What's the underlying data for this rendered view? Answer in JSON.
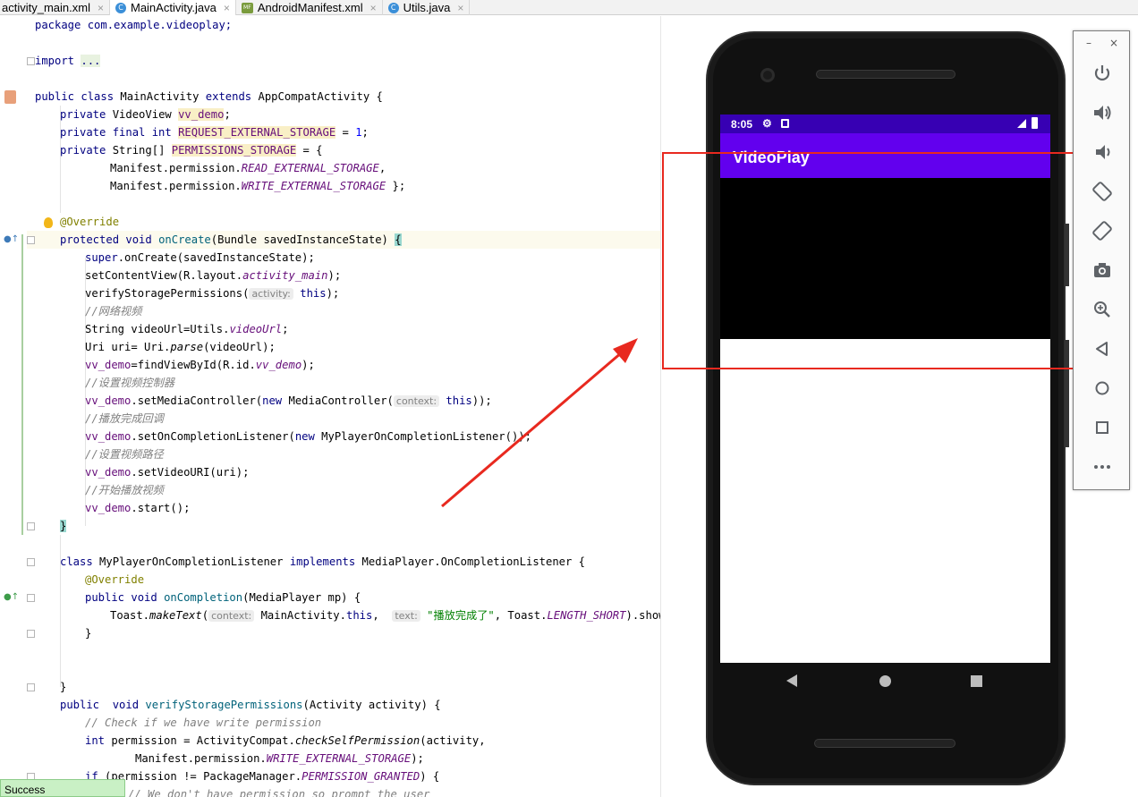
{
  "tabs": [
    {
      "label": "activity_main.xml",
      "icon": "xml-file-icon"
    },
    {
      "label": "MainActivity.java",
      "icon": "java-class-icon",
      "active": true
    },
    {
      "label": "AndroidManifest.xml",
      "icon": "manifest-file-icon"
    },
    {
      "label": "Utils.java",
      "icon": "java-class-icon"
    }
  ],
  "code": {
    "l1": "package com.example.videoplay;",
    "import_kw": "import",
    "import_fold": "...",
    "class_decl_a": "public class ",
    "class_decl_b": "MainActivity ",
    "class_decl_c": "extends ",
    "class_decl_d": "AppCompatActivity {",
    "f1_a": "private ",
    "f1_b": "VideoView ",
    "f1_c": "vv_demo",
    "f1_d": ";",
    "f2_a": "private final int ",
    "f2_b": "REQUEST_EXTERNAL_STORAGE",
    "f2_c": " = ",
    "f2_d": "1",
    "f2_e": ";",
    "f3_a": "private ",
    "f3_b": "String[] ",
    "f3_c": "PERMISSIONS_STORAGE",
    "f3_d": " = {",
    "f4_a": "Manifest.permission.",
    "f4_b": "READ_EXTERNAL_STORAGE",
    "f4_c": ",",
    "f5_a": "Manifest.permission.",
    "f5_b": "WRITE_EXTERNAL_STORAGE",
    "f5_c": " };",
    "override1": "@Override",
    "oc_a": "protected void ",
    "oc_b": "onCreate",
    "oc_c": "(Bundle savedInstanceState) ",
    "oc_d": "{",
    "s1_a": "super",
    "s1_b": ".onCreate(savedInstanceState);",
    "s2_a": "setContentView(R.layout.",
    "s2_b": "activity_main",
    "s2_c": ");",
    "s3_a": "verifyStoragePermissions(",
    "s3_hint": "activity:",
    "s3_b": " this",
    "s3_c": ");",
    "c1": "//网络视频",
    "s4_a": "String videoUrl=Utils.",
    "s4_b": "videoUrl",
    "s4_c": ";",
    "s5_a": "Uri uri= Uri.",
    "s5_b": "parse",
    "s5_c": "(videoUrl);",
    "s6_a": "vv_demo",
    "s6_b": "=findViewById(R.id.",
    "s6_c": "vv_demo",
    "s6_d": ");",
    "c2": "//设置视频控制器",
    "s7_a": "vv_demo",
    "s7_b": ".setMediaController(",
    "s7_c": "new ",
    "s7_d": "MediaController(",
    "s7_hint": "context:",
    "s7_e": " this",
    "s7_f": "));",
    "c3": "//播放完成回调",
    "s8_a": "vv_demo",
    "s8_b": ".setOnCompletionListener(",
    "s8_c": "new ",
    "s8_d": "MyPlayerOnCompletionListener());",
    "c4": "//设置视频路径",
    "s9_a": "vv_demo",
    "s9_b": ".setVideoURI(uri);",
    "c5": "//开始播放视频",
    "s10_a": "vv_demo",
    "s10_b": ".start();",
    "close1": "}",
    "cl_a": "class ",
    "cl_b": "MyPlayerOnCompletionListener ",
    "cl_c": "implements ",
    "cl_d": "MediaPlayer.OnCompletionListener {",
    "override2": "@Override",
    "occ_a": "public void ",
    "occ_b": "onCompletion",
    "occ_c": "(MediaPlayer mp) {",
    "t_a": "Toast.",
    "t_b": "makeText",
    "t_c": "(",
    "t_hint1": "context:",
    "t_d": " MainActivity.",
    "t_e": "this",
    "t_f": ",  ",
    "t_hint2": "text:",
    "t_g": " \"播放完成了\"",
    "t_h": ", Toast.",
    "t_i": "LENGTH_SHORT",
    "t_j": ").show();",
    "close2": "}",
    "close3": "}",
    "vp_a": "public  void ",
    "vp_b": "verifyStoragePermissions",
    "vp_c": "(Activity activity) {",
    "c6": "// Check if we have write permission",
    "p1_a": "int ",
    "p1_b": "permission = ActivityCompat.",
    "p1_c": "checkSelfPermission",
    "p1_d": "(activity,",
    "p2_a": "Manifest.permission.",
    "p2_b": "WRITE_EXTERNAL_STORAGE",
    "p2_c": ");",
    "p3_a": "if ",
    "p3_b": "(permission != PackageManager.",
    "p3_c": "PERMISSION_GRANTED",
    "p3_d": ") {",
    "c7": "// We don't have permission so prompt the user"
  },
  "status_popup": "Success",
  "phone": {
    "time": "8:05",
    "app_title": "VideoPlay",
    "nav": [
      "back",
      "home",
      "recents"
    ]
  },
  "emulator_controls": {
    "minimize": "–",
    "close": "×",
    "buttons": [
      "power",
      "volume-up",
      "volume-down",
      "rotate-left",
      "rotate-right",
      "screenshot",
      "zoom",
      "back",
      "home",
      "overview",
      "more"
    ]
  },
  "colors": {
    "status_bar": "#3700b3",
    "app_bar": "#6200ee",
    "annotation_red": "#e8291f",
    "keyword": "#000080",
    "field": "#660e7a",
    "comment": "#808080"
  }
}
